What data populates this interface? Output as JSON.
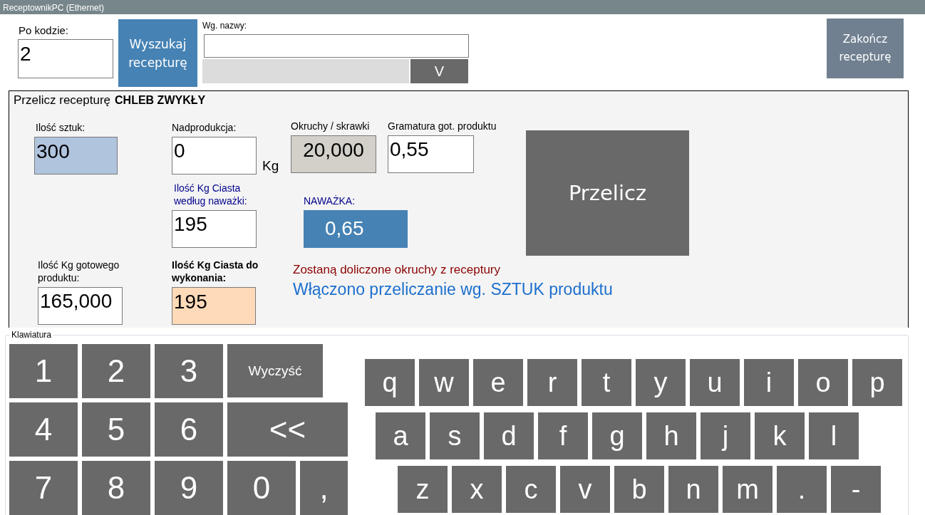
{
  "window": {
    "title": "ReceptownikPC (Ethernet)"
  },
  "search": {
    "code_label": "Po kodzie:",
    "code_value": "2",
    "search_button": "Wyszukaj recepturę",
    "name_label": "Wg. nazwy:",
    "dropdown_button": "V"
  },
  "finish_button": "Zakończ recepturę",
  "recalc": {
    "title": "Przelicz recepturę",
    "recipe_name": "CHLEB ZWYKŁY",
    "pieces": {
      "label": "Ilość sztuk:",
      "value": "300"
    },
    "overproduction": {
      "label": "Nadprodukcja:",
      "value": "0",
      "unit": "Kg"
    },
    "crumbs": {
      "label": "Okruchy / skrawki",
      "value": "20,000"
    },
    "weight": {
      "label": "Gramatura got. produktu",
      "value": "0,55"
    },
    "recalc_button": "Przelicz",
    "dough_by_portion": {
      "label": "Ilość Kg Ciasta według naważki:",
      "value": "195"
    },
    "portion": {
      "label": "NAWAŻKA:",
      "value": "0,65"
    },
    "finished_kg": {
      "label": "Ilość Kg gotowego produktu:",
      "value": "165,000"
    },
    "dough_to_make": {
      "label": "Ilość Kg Ciasta do wykonania:",
      "value": "195"
    },
    "crumbs_note": "Zostaną doliczone okruchy z receptury",
    "mode_note": "Włączono przeliczanie wg. SZTUK produktu"
  },
  "keyboard": {
    "legend": "Klawiatura",
    "numpad": [
      [
        "1",
        "2",
        "3",
        "Wyczyść"
      ],
      [
        "4",
        "5",
        "6",
        "<<"
      ],
      [
        "7",
        "8",
        "9",
        "0",
        ","
      ]
    ],
    "letters": [
      [
        "q",
        "w",
        "e",
        "r",
        "t",
        "y",
        "u",
        "i",
        "o",
        "p"
      ],
      [
        "a",
        "s",
        "d",
        "f",
        "g",
        "h",
        "j",
        "k",
        "l"
      ],
      [
        "z",
        "x",
        "c",
        "v",
        "b",
        "n",
        "m",
        ".",
        "-"
      ]
    ]
  }
}
